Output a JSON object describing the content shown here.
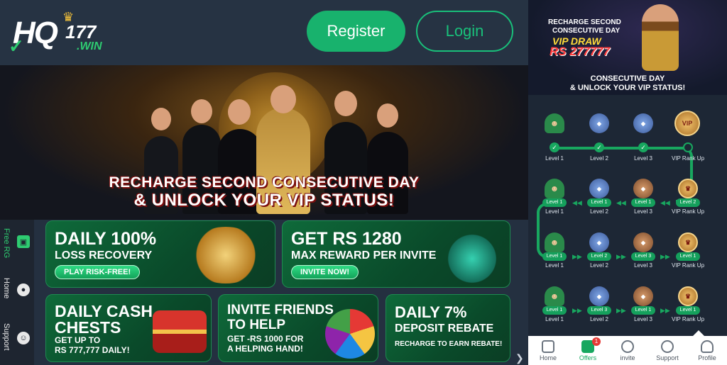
{
  "header": {
    "logo": {
      "brand": "HQ",
      "number": "177",
      "domain": ".WIN"
    },
    "register_label": "Register",
    "login_label": "Login"
  },
  "hero": {
    "line1": "RECHARGE SECOND CONSECUTIVE DAY",
    "line2": "& UNLOCK YOUR VIP STATUS!"
  },
  "sidebar": {
    "items": [
      {
        "label": "Free RG",
        "icon": "gift-icon",
        "active": true
      },
      {
        "label": "Home",
        "icon": "chat-icon",
        "active": false
      },
      {
        "label": "Support",
        "icon": "smile-icon",
        "active": false
      }
    ]
  },
  "promos": [
    {
      "title": "DAILY 100%",
      "subtitle": "LOSS RECOVERY",
      "button": "PLAY RISK-FREE!"
    },
    {
      "title": "GET RS 1280",
      "subtitle": "MAX REWARD PER INVITE",
      "button": "INVITE NOW!"
    },
    {
      "title_1": "DAILY CASH",
      "title_2": "CHESTS",
      "sub_1": "GET UP TO",
      "sub_2": "RS 777,777 DAILY!"
    },
    {
      "title_1": "INVITE FRIENDS",
      "title_2": "TO HELP",
      "sub_1": "GET -RS 1000 FOR",
      "sub_2": "A HELPING HAND!"
    },
    {
      "title_1": "DAILY 7%",
      "title_2": "DEPOSIT REBATE",
      "sub_1": "RECHARGE TO EARN REBATE!"
    }
  ],
  "right_banner": {
    "line1": "RECHARGE SECOND",
    "line2": "CONSECUTIVE DAY",
    "line3": "VIP DRAW",
    "line4": "RS 277777",
    "bottom1": "CONSECUTIVE DAY",
    "bottom2": "& UNLOCK YOUR VIP STATUS!"
  },
  "journey": {
    "row1": [
      "Level 1",
      "Level 2",
      "Level 3",
      "VIP Rank Up"
    ],
    "row1_vip_badge": "VIP",
    "row2_pills": [
      "Level 1",
      "Level 1",
      "Level 1",
      "Level 2"
    ],
    "row2": [
      "Level 1",
      "Level 2",
      "Level 3",
      "VIP Rank Up"
    ],
    "row3_pills": [
      "Level 1",
      "Level 2",
      "Level 3",
      "Level 1"
    ],
    "row3": [
      "Level 1",
      "Level 2",
      "Level 3",
      "VIP Rank Up"
    ],
    "row4_pills": [
      "Level 1",
      "Level 3",
      "Level 1",
      "Level 1"
    ],
    "row4": [
      "Level 1",
      "Level 2",
      "Level 3",
      "VIP Rank Up"
    ]
  },
  "tabbar": {
    "items": [
      {
        "label": "Home",
        "icon": "home-icon"
      },
      {
        "label": "Offers",
        "icon": "gift-icon",
        "badge": "1",
        "active": true
      },
      {
        "label": "invite",
        "icon": "users-icon"
      },
      {
        "label": "Support",
        "icon": "headset-icon"
      },
      {
        "label": "Profile",
        "icon": "person-icon"
      }
    ]
  },
  "colors": {
    "brand_green": "#18b26d",
    "card_green": "#0f6a3a",
    "gold": "#f5c542",
    "header_bg": "#263343"
  }
}
